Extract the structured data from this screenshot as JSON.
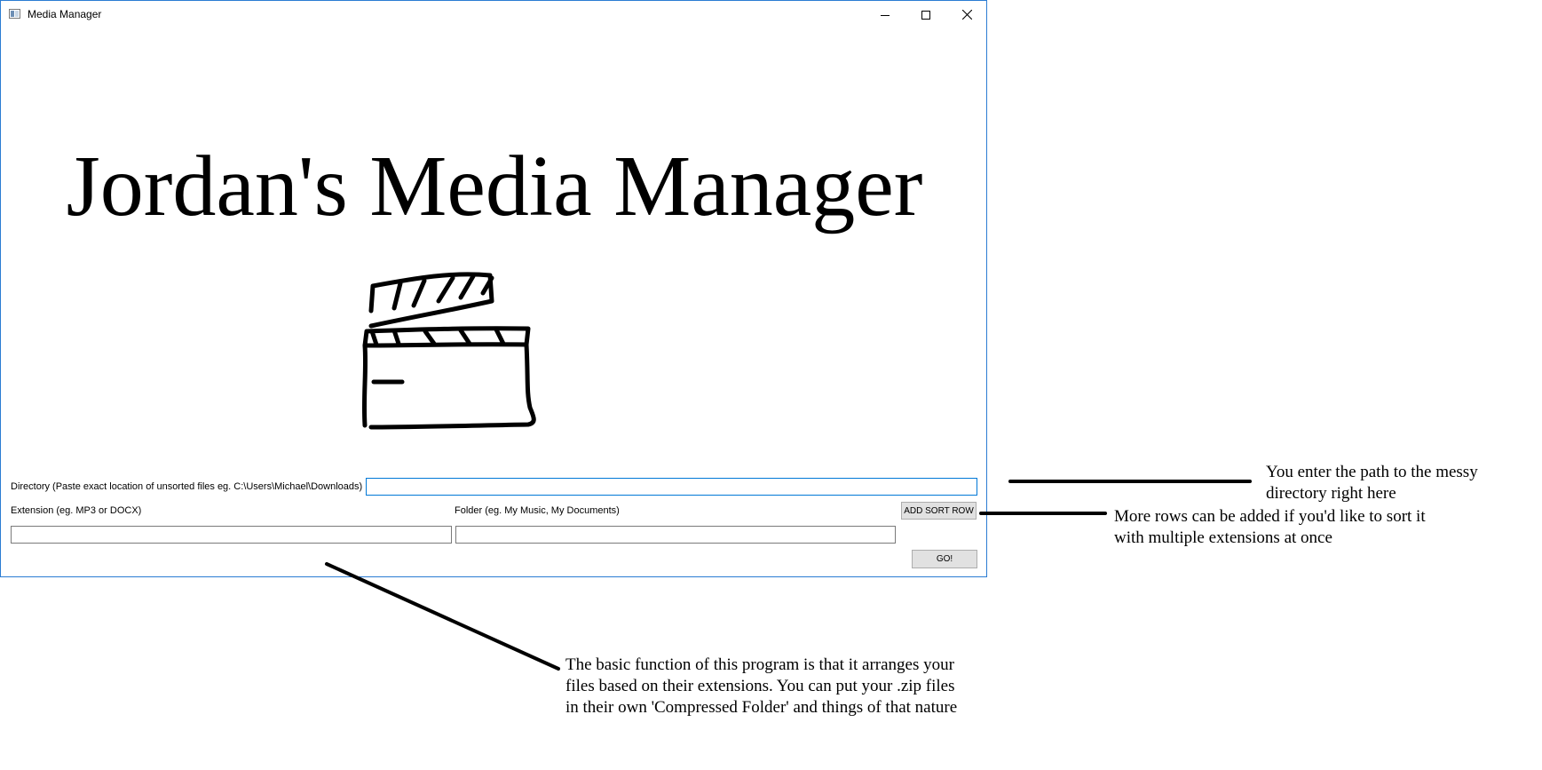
{
  "window": {
    "title": "Media Manager",
    "icon": "app-window-icon",
    "controls": [
      "minimize-icon",
      "maximize-icon",
      "close-icon"
    ],
    "border_color": "#2b7cd3"
  },
  "main": {
    "headline": "Jordan's Media Manager",
    "logo_icon": "clapperboard-icon"
  },
  "form": {
    "directory_label": "Directory (Paste exact location of unsorted files eg. C:\\Users\\Michael\\Downloads)",
    "directory_value": "",
    "extension_label": "Extension (eg. MP3 or DOCX)",
    "extension_value": "",
    "folder_label": "Folder (eg. My Music, My Documents)",
    "folder_value": "",
    "add_sort_row_label": "ADD SORT ROW",
    "go_label": "GO!",
    "focus_color": "#0078d7"
  },
  "annotations": {
    "directory_note": [
      "You enter the path to the messy",
      "directory right here"
    ],
    "rows_note": [
      "More rows can be added if you'd like to sort it",
      "with multiple extensions at once"
    ],
    "function_note": [
      "The basic function of this program is that it arranges your",
      "files based on their extensions. You can put your .zip files",
      "in their own 'Compressed Folder' and things of that nature"
    ]
  }
}
